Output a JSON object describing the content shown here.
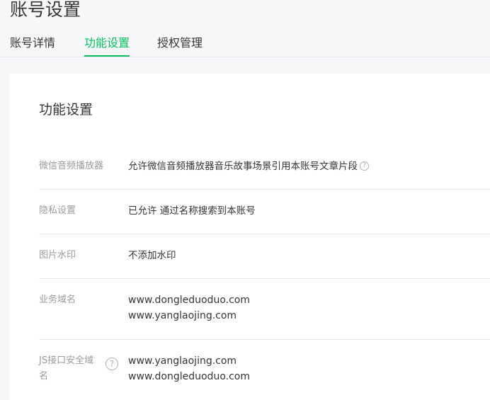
{
  "page": {
    "title": "账号设置"
  },
  "tabs": [
    {
      "label": "账号详情",
      "active": false
    },
    {
      "label": "功能设置",
      "active": true
    },
    {
      "label": "授权管理",
      "active": false
    }
  ],
  "section": {
    "title": "功能设置"
  },
  "settings": {
    "player": {
      "label": "微信音频播放器",
      "value": "允许微信音频播放器音乐故事场景引用本账号文章片段",
      "icon": "help-circle-icon"
    },
    "privacy": {
      "label": "隐私设置",
      "value": "已允许 通过名称搜索到本账号"
    },
    "watermark": {
      "label": "图片水印",
      "value": "不添加水印"
    },
    "business_domain": {
      "label": "业务域名",
      "domains": [
        "www.dongleduoduo.com",
        "www.yanglaojing.com"
      ]
    },
    "js_domain": {
      "label_line1": "JS接口安全域",
      "label_line2": "名",
      "icon": "help-circle-icon",
      "domains": [
        "www.yanglaojing.com",
        "www.dongleduoduo.com"
      ]
    }
  },
  "colors": {
    "accent": "#07c160",
    "label": "#9a9a9a",
    "text": "#353535",
    "background": "#f6f7f8",
    "divider": "#e7e7eb"
  }
}
